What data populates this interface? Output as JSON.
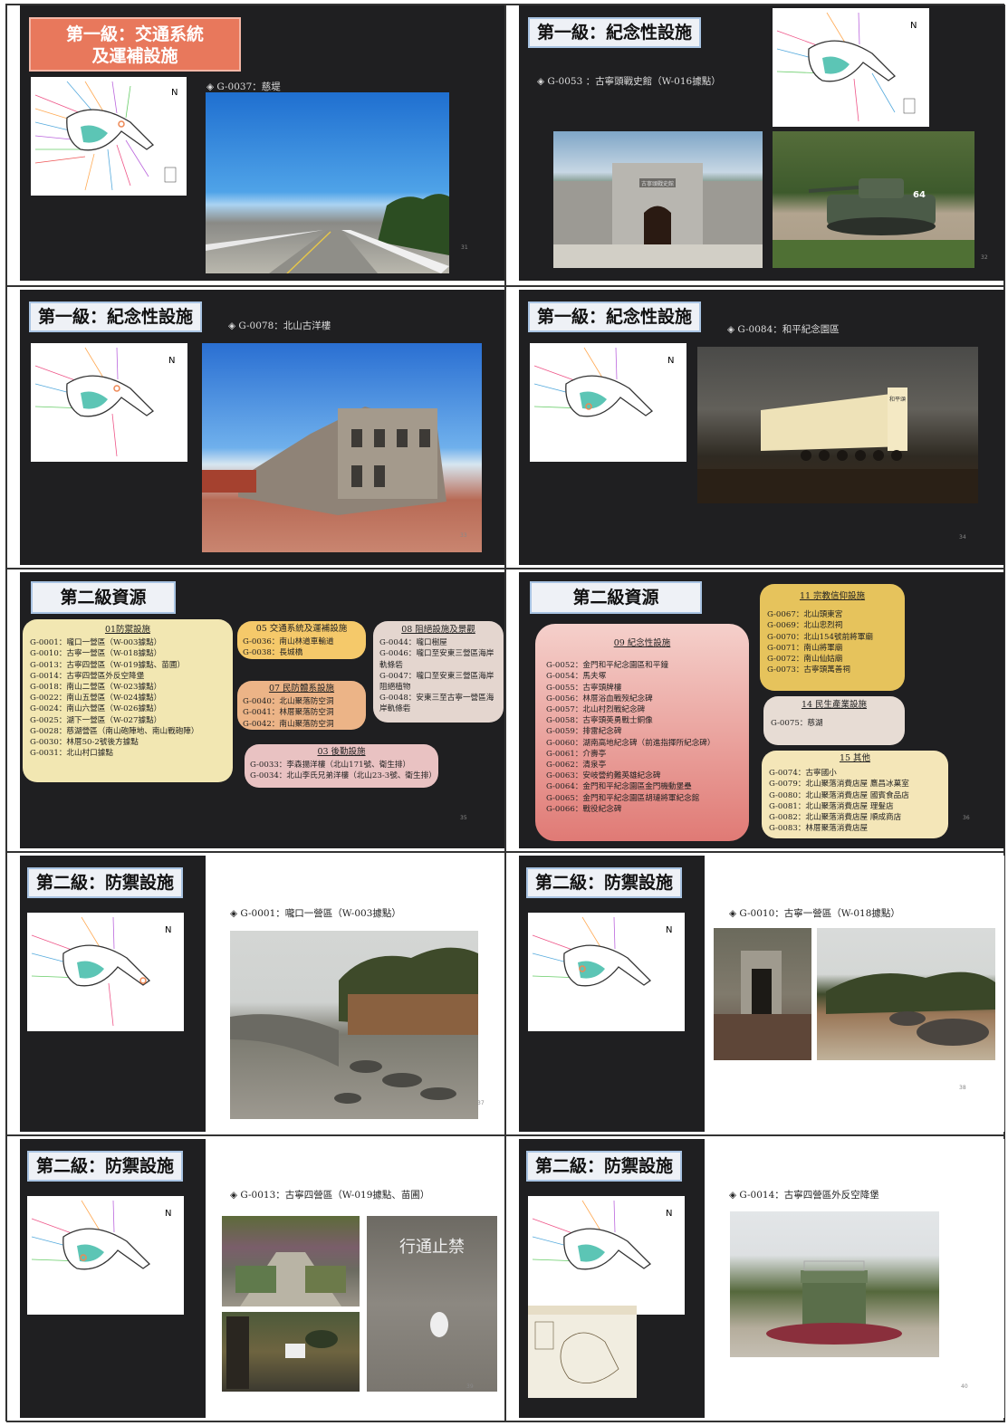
{
  "slides": [
    {
      "title": "第一級：交通系統\n及運補設施",
      "caption": "◈ G-0037：慈堤",
      "page": "31"
    },
    {
      "title": "第一級：紀念性設施",
      "caption": "◈ G-0053 ：古寧頭戰史館（W-016據點）",
      "page": "32",
      "tank_number": "64",
      "museum_sign": "古寧頭戰史館"
    },
    {
      "title": "第一級：紀念性設施",
      "caption": "◈ G-0078：北山古洋樓",
      "page": "33"
    },
    {
      "title": "第一級：紀念性設施",
      "caption": "◈ G-0084：和平紀念園區",
      "page": "34",
      "wall_sign": "和平頌"
    },
    {
      "title": "第二級資源",
      "page": "35",
      "boxes": [
        {
          "heading": "01防禦設施",
          "lines": [
            "G-0001：嚨口一營區（W-003據點）",
            "G-0010：古寧一營區（W-018據點）",
            "G-0013：古寧四營區（W-019據點、苗圃）",
            "G-0014：古寧四營區外反空降堡",
            "G-0018：南山二營區（W-023據點）",
            "G-0022：南山五營區（W-024據點）",
            "G-0024：南山六營區（W-026據點）",
            "G-0025：湖下一營區（W-027據點）",
            "G-0028：慈湖營區（南山砲陣地、南山戰砲陣）",
            "G-0030：林厝50-2號後方據點",
            "G-0031：北山村口據點"
          ]
        },
        {
          "heading": "05 交通系統及運補設施",
          "lines": [
            "G-0036：南山林道車輸道",
            "G-0038：長城橋"
          ]
        },
        {
          "heading": "07 民防體系設施",
          "lines": [
            "G-0040：北山聚落防空洞",
            "G-0041：林厝聚落防空洞",
            "G-0042：南山聚落防空洞"
          ]
        },
        {
          "heading": "03 後勤設施",
          "lines": [
            "G-0033：李森揚洋樓（北山171號、衛生排）",
            "G-0034：北山李氏兄弟洋樓（北山23-3號、衛生排）"
          ]
        },
        {
          "heading": "08 阻絕設施及景觀",
          "lines": [
            "G-0044：嚨口樹屋",
            "G-0046：嚨口至安東三營區海岸軌條砦",
            "G-0047：嚨口至安東三營區海岸阻絕植物",
            "G-0048：安東三至古寧一營區海岸軌條砦"
          ]
        }
      ]
    },
    {
      "title": "第二級資源",
      "page": "36",
      "boxes": [
        {
          "heading": "09 紀念性設施",
          "lines": [
            "G-0052：金門和平紀念園區和平鐘",
            "G-0054：馬夫塚",
            "G-0055：古寧頭牌樓",
            "G-0056：林厝浴血戰歿紀念碑",
            "G-0057：北山村烈戰紀念碑",
            "G-0058：古寧頭英勇戰士銅像",
            "G-0059：排雷紀念碑",
            "G-0060：湖南高地紀念碑（前進指揮所紀念碑）",
            "G-0061：介壽亭",
            "G-0062：清泉亭",
            "G-0063：安岐營約難英雄紀念碑",
            "G-0064：金門和平紀念園區金門機動堡壘",
            "G-0065：金門和平紀念園區胡璉將軍紀念館",
            "G-0066：戰役紀念碑"
          ]
        },
        {
          "heading": "11 宗教信仰設施",
          "lines": [
            "G-0067：北山頭東宮",
            "G-0069：北山忠烈祠",
            "G-0070：北山154號前將軍廟",
            "G-0071：南山將軍廟",
            "G-0072：南山仙姑廟",
            "G-0073：古寧頭萬善祠"
          ]
        },
        {
          "heading": "14 民生產業設施",
          "lines": [
            "G-0075：慈湖"
          ]
        },
        {
          "heading": "15 其他",
          "lines": [
            "G-0074：古寧國小",
            "G-0079：北山聚落消費店屋 鷹昌冰菓室",
            "G-0080：北山聚落消費店屋 國賓食品店",
            "G-0081：北山聚落消費店屋 理髮店",
            "G-0082：北山聚落消費店屋 順成商店",
            "G-0083：林厝聚落消費店屋"
          ]
        }
      ]
    },
    {
      "title": "第二級：防禦設施",
      "caption": "◈ G-0001：嚨口一營區（W-003據點）",
      "page": "37"
    },
    {
      "title": "第二級：防禦設施",
      "caption": "◈ G-0010：古寧一營區（W-018據點）",
      "page": "38"
    },
    {
      "title": "第二級：防禦設施",
      "caption": "◈ G-0013：古寧四營區（W-019據點、苗圃）",
      "page": "39",
      "sign_text": "行通止禁"
    },
    {
      "title": "第二級：防禦設施",
      "caption": "◈ G-0014：古寧四營區外反空降堡",
      "page": "40"
    }
  ],
  "colors": {
    "slide_bg": "#1f1f21",
    "title_bg": "#eef1f6",
    "title_border": "#a9c4e3",
    "accent_orange": "#e8785c"
  }
}
